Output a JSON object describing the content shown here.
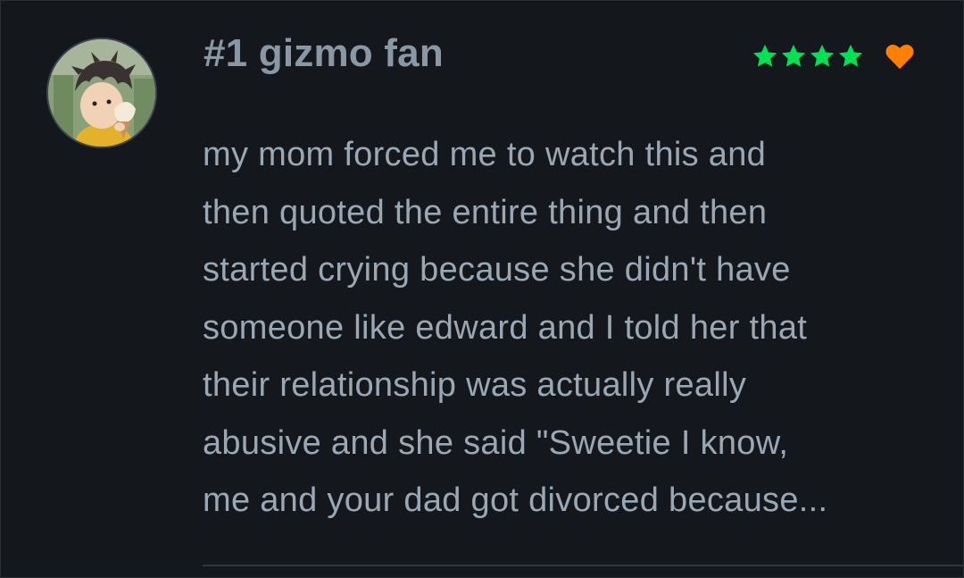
{
  "review": {
    "username": "#1 gizmo fan",
    "rating_stars": 4,
    "liked": true,
    "lines": [
      "my mom forced me to watch this and",
      "then quoted the entire thing and then",
      "started crying because she didn't have",
      "someone like edward and I told her that",
      "their relationship was actually really",
      "abusive and she said \"Sweetie I know,",
      "me and your dad got divorced because..."
    ]
  },
  "colors": {
    "star": "#00e054",
    "heart": "#ff8000",
    "text": "#9aa7b4",
    "username": "#8a97a5",
    "background": "#14181c"
  },
  "icons": {
    "star": "star-icon",
    "heart": "heart-icon"
  }
}
